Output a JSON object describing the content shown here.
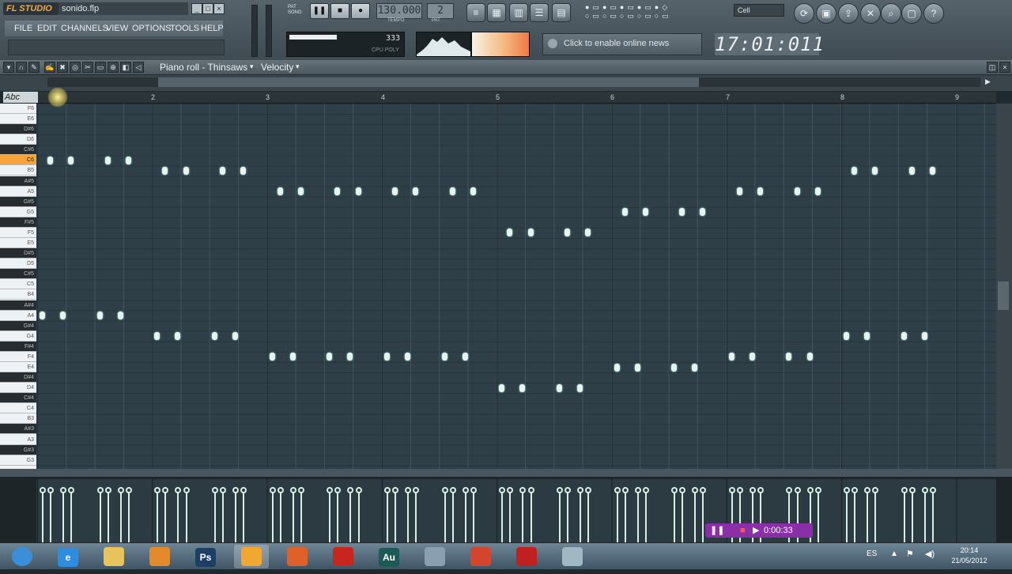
{
  "app": {
    "logo_text": "FL STUDIO",
    "file_name": "sonido.flp"
  },
  "menu": [
    "FILE",
    "EDIT",
    "CHANNELS",
    "VIEW",
    "OPTIONS",
    "TOOLS",
    "HELP"
  ],
  "transport": {
    "tempo": "130.000",
    "pattern": "2",
    "tempo_label": "TEMPO",
    "pattern_label": "PAT"
  },
  "cpu": {
    "value": "333",
    "label": "CPU POLY"
  },
  "news": {
    "text": "Click to enable online news"
  },
  "clock": {
    "time": "17:01:011"
  },
  "cell": {
    "label": "Cell"
  },
  "piano_roll": {
    "title": "Piano roll - Thinsaws",
    "target": "Velocity",
    "bar_numbers": [
      "2",
      "3",
      "4",
      "5",
      "6",
      "7",
      "8",
      "9"
    ],
    "keyboard_label": "Abc",
    "keys": [
      {
        "label": "F6",
        "black": false
      },
      {
        "label": "E6",
        "black": false
      },
      {
        "label": "D#6",
        "black": true
      },
      {
        "label": "D6",
        "black": false
      },
      {
        "label": "C#6",
        "black": true
      },
      {
        "label": "C6",
        "black": false,
        "highlight": true
      },
      {
        "label": "B5",
        "black": false
      },
      {
        "label": "A#5",
        "black": true
      },
      {
        "label": "A5",
        "black": false
      },
      {
        "label": "G#5",
        "black": true
      },
      {
        "label": "G5",
        "black": false
      },
      {
        "label": "F#5",
        "black": true
      },
      {
        "label": "F5",
        "black": false
      },
      {
        "label": "E5",
        "black": false
      },
      {
        "label": "D#5",
        "black": true
      },
      {
        "label": "D5",
        "black": false
      },
      {
        "label": "C#5",
        "black": true
      },
      {
        "label": "C5",
        "black": false
      },
      {
        "label": "B4",
        "black": false
      },
      {
        "label": "A#4",
        "black": true
      },
      {
        "label": "A4",
        "black": false
      },
      {
        "label": "G#4",
        "black": true
      },
      {
        "label": "G4",
        "black": false
      },
      {
        "label": "F#4",
        "black": true
      },
      {
        "label": "F4",
        "black": false
      },
      {
        "label": "E4",
        "black": false
      },
      {
        "label": "D#4",
        "black": true
      },
      {
        "label": "D4",
        "black": false
      },
      {
        "label": "C#4",
        "black": true
      },
      {
        "label": "C4",
        "black": false
      },
      {
        "label": "B3",
        "black": false
      },
      {
        "label": "A#3",
        "black": true
      },
      {
        "label": "A3",
        "black": false
      },
      {
        "label": "G#3",
        "black": true
      },
      {
        "label": "G3",
        "black": false
      }
    ],
    "notes": [
      {
        "bar": 1.07,
        "pitch": "C6"
      },
      {
        "bar": 1.25,
        "pitch": "C6"
      },
      {
        "bar": 1.57,
        "pitch": "C6"
      },
      {
        "bar": 1.75,
        "pitch": "C6"
      },
      {
        "bar": 2.07,
        "pitch": "B5"
      },
      {
        "bar": 2.25,
        "pitch": "B5"
      },
      {
        "bar": 2.57,
        "pitch": "B5"
      },
      {
        "bar": 2.75,
        "pitch": "B5"
      },
      {
        "bar": 3.07,
        "pitch": "A5"
      },
      {
        "bar": 3.25,
        "pitch": "A5"
      },
      {
        "bar": 3.57,
        "pitch": "A5"
      },
      {
        "bar": 3.75,
        "pitch": "A5"
      },
      {
        "bar": 4.07,
        "pitch": "A5"
      },
      {
        "bar": 4.25,
        "pitch": "A5"
      },
      {
        "bar": 4.57,
        "pitch": "A5"
      },
      {
        "bar": 4.75,
        "pitch": "A5"
      },
      {
        "bar": 5.07,
        "pitch": "F5"
      },
      {
        "bar": 5.25,
        "pitch": "F5"
      },
      {
        "bar": 5.57,
        "pitch": "F5"
      },
      {
        "bar": 5.75,
        "pitch": "F5"
      },
      {
        "bar": 6.07,
        "pitch": "G5"
      },
      {
        "bar": 6.25,
        "pitch": "G5"
      },
      {
        "bar": 6.57,
        "pitch": "G5"
      },
      {
        "bar": 6.75,
        "pitch": "G5"
      },
      {
        "bar": 7.07,
        "pitch": "A5"
      },
      {
        "bar": 7.25,
        "pitch": "A5"
      },
      {
        "bar": 7.57,
        "pitch": "A5"
      },
      {
        "bar": 7.75,
        "pitch": "A5"
      },
      {
        "bar": 8.07,
        "pitch": "B5"
      },
      {
        "bar": 8.25,
        "pitch": "B5"
      },
      {
        "bar": 8.57,
        "pitch": "B5"
      },
      {
        "bar": 8.75,
        "pitch": "B5"
      },
      {
        "bar": 1.0,
        "pitch": "A4"
      },
      {
        "bar": 1.18,
        "pitch": "A4"
      },
      {
        "bar": 1.5,
        "pitch": "A4"
      },
      {
        "bar": 1.68,
        "pitch": "A4"
      },
      {
        "bar": 2.0,
        "pitch": "G4"
      },
      {
        "bar": 2.18,
        "pitch": "G4"
      },
      {
        "bar": 2.5,
        "pitch": "G4"
      },
      {
        "bar": 2.68,
        "pitch": "G4"
      },
      {
        "bar": 3.0,
        "pitch": "F4"
      },
      {
        "bar": 3.18,
        "pitch": "F4"
      },
      {
        "bar": 3.5,
        "pitch": "F4"
      },
      {
        "bar": 3.68,
        "pitch": "F4"
      },
      {
        "bar": 4.0,
        "pitch": "F4"
      },
      {
        "bar": 4.18,
        "pitch": "F4"
      },
      {
        "bar": 4.5,
        "pitch": "F4"
      },
      {
        "bar": 4.68,
        "pitch": "F4"
      },
      {
        "bar": 5.0,
        "pitch": "D4"
      },
      {
        "bar": 5.18,
        "pitch": "D4"
      },
      {
        "bar": 5.5,
        "pitch": "D4"
      },
      {
        "bar": 5.68,
        "pitch": "D4"
      },
      {
        "bar": 6.0,
        "pitch": "E4"
      },
      {
        "bar": 6.18,
        "pitch": "E4"
      },
      {
        "bar": 6.5,
        "pitch": "E4"
      },
      {
        "bar": 6.68,
        "pitch": "E4"
      },
      {
        "bar": 7.0,
        "pitch": "F4"
      },
      {
        "bar": 7.18,
        "pitch": "F4"
      },
      {
        "bar": 7.5,
        "pitch": "F4"
      },
      {
        "bar": 7.68,
        "pitch": "F4"
      },
      {
        "bar": 8.0,
        "pitch": "G4"
      },
      {
        "bar": 8.18,
        "pitch": "G4"
      },
      {
        "bar": 8.5,
        "pitch": "G4"
      },
      {
        "bar": 8.68,
        "pitch": "G4"
      }
    ]
  },
  "recorder": {
    "time": "0:00:33"
  },
  "taskbar": {
    "apps": [
      {
        "name": "start",
        "icon": "windows-icon",
        "label": "",
        "color": "#3b8fd9"
      },
      {
        "name": "ie",
        "icon": "internet-explorer-icon",
        "label": "e",
        "color": "#2f8de0"
      },
      {
        "name": "explorer",
        "icon": "folder-icon",
        "label": "",
        "color": "#e8c25a"
      },
      {
        "name": "media",
        "icon": "media-player-icon",
        "label": "",
        "color": "#e38a2a"
      },
      {
        "name": "photoshop",
        "icon": "photoshop-icon",
        "label": "Ps",
        "color": "#1d3f66"
      },
      {
        "name": "flstudio",
        "icon": "fl-studio-icon",
        "label": "",
        "color": "#f0a830"
      },
      {
        "name": "firefox",
        "icon": "firefox-icon",
        "label": "",
        "color": "#e0602a"
      },
      {
        "name": "app8",
        "icon": "red-app-icon",
        "label": "",
        "color": "#c8251f"
      },
      {
        "name": "audition",
        "icon": "audition-icon",
        "label": "Au",
        "color": "#1c5a55"
      },
      {
        "name": "player",
        "icon": "play-icon",
        "label": "",
        "color": "#8aa0b0"
      },
      {
        "name": "chrome",
        "icon": "chrome-icon",
        "label": "",
        "color": "#d4452e"
      },
      {
        "name": "poker",
        "icon": "spade-icon",
        "label": "",
        "color": "#c02020"
      },
      {
        "name": "fl2",
        "icon": "fl-fruit-icon",
        "label": "",
        "color": "#9fb8c4"
      }
    ],
    "lang": "ES",
    "time": "20:14",
    "date": "21/05/2012"
  }
}
